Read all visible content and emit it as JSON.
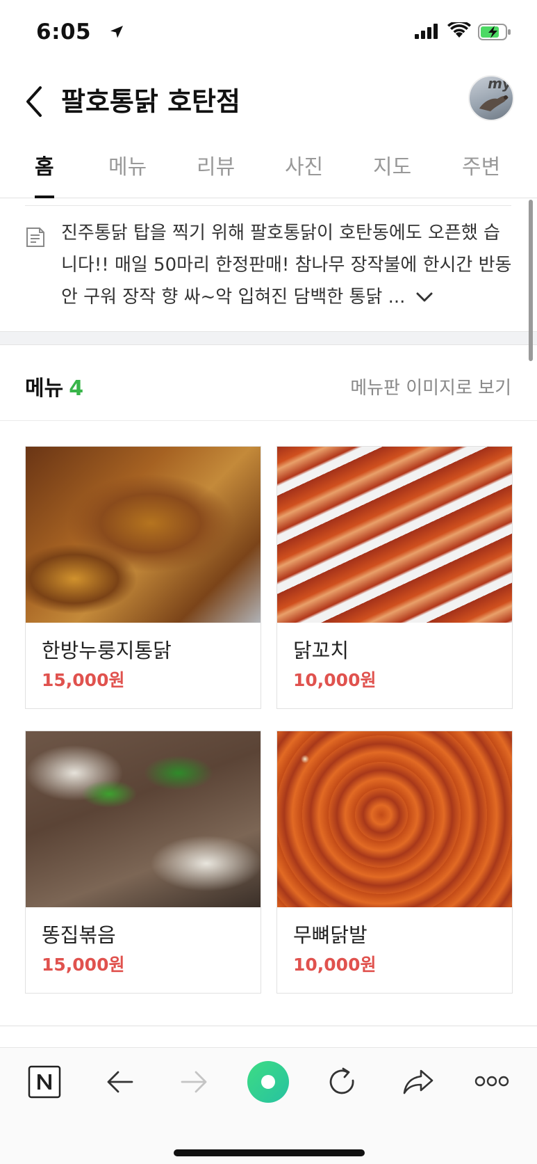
{
  "status_bar": {
    "time": "6:05"
  },
  "header": {
    "title": "팔호통닭 호탄점",
    "avatar_text": "my"
  },
  "tabs": [
    {
      "label": "홈",
      "active": true
    },
    {
      "label": "메뉴"
    },
    {
      "label": "리뷰"
    },
    {
      "label": "사진"
    },
    {
      "label": "지도"
    },
    {
      "label": "주변"
    }
  ],
  "description": {
    "text": "진주통닭 탑을 찍기 위해 팔호통닭이 호탄동에도 오픈했 습니다!! 매일 50마리 한정판매! 참나무 장작불에 한시간 반동안 구워 장작 향 싸~악 입혀진 담백한 통닭 ..."
  },
  "menu": {
    "title": "메뉴",
    "count": "4",
    "view_board_link": "메뉴판 이미지로 보기",
    "items": [
      {
        "name": "한방누룽지통닭",
        "price": "15,000원"
      },
      {
        "name": "닭꼬치",
        "price": "10,000원"
      },
      {
        "name": "똥집볶음",
        "price": "15,000원"
      },
      {
        "name": "무뼈닭발",
        "price": "10,000원"
      }
    ]
  },
  "colors": {
    "accent_green": "#39b54a",
    "price_red": "#e0524e"
  },
  "icons": [
    "location-arrow-icon",
    "signal-icon",
    "wifi-icon",
    "battery-charging-icon",
    "back-chevron-icon",
    "document-icon",
    "chevron-down-icon",
    "naver-n-icon",
    "arrow-left-icon",
    "arrow-right-icon",
    "green-dot-icon",
    "refresh-icon",
    "share-icon",
    "more-icon"
  ]
}
